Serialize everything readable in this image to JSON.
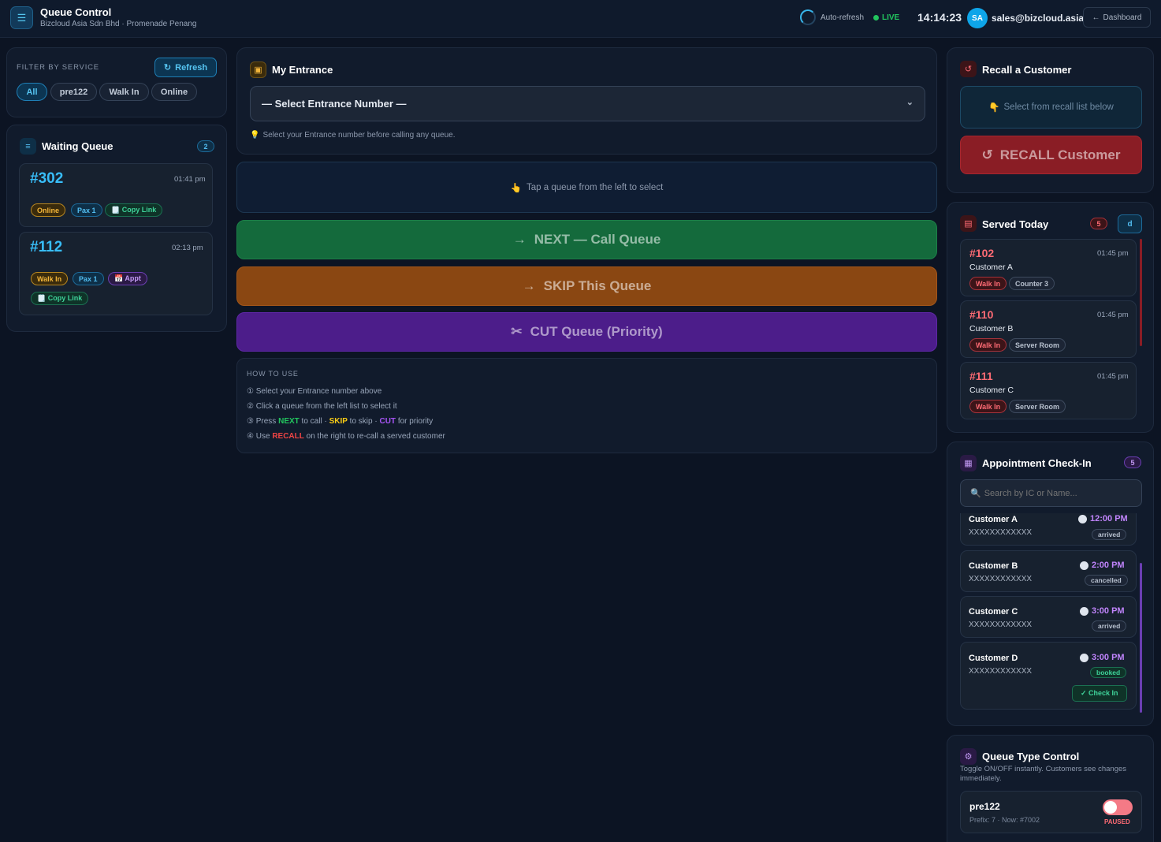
{
  "header": {
    "title": "Queue Control",
    "subtitle": "Bizcloud Asia Sdn Bhd · Promenade Penang",
    "auto_refresh": "Auto-refresh",
    "live": "LIVE",
    "time": "14:14:23",
    "avatar": "SA",
    "email": "sales@bizcloud.asia",
    "dashboard": "Dashboard"
  },
  "filter": {
    "label": "FILTER BY SERVICE",
    "refresh": "Refresh",
    "options": [
      "All",
      "pre122",
      "Walk In",
      "Online"
    ],
    "selected": "All"
  },
  "waiting": {
    "title": "Waiting Queue",
    "count": "2",
    "items": [
      {
        "number": "#302",
        "time": "01:41 pm",
        "type": "Online",
        "pax": "Pax 1",
        "copy": "🗒️ Copy Link"
      },
      {
        "number": "#112",
        "time": "02:13 pm",
        "type": "Walk In",
        "pax": "Pax 1",
        "appt": "📅 Appt",
        "copy": "🗒️ Copy Link"
      }
    ]
  },
  "entrance": {
    "title": "My Entrance",
    "select_placeholder": "— Select Entrance Number —",
    "hint": "Select your Entrance number before calling any queue."
  },
  "selected_queue": {
    "hint": "Tap a queue from the left to select"
  },
  "actions": {
    "next": "NEXT — Call Queue",
    "skip": "SKIP This Queue",
    "cut": "CUT Queue (Priority)"
  },
  "howto": {
    "title": "HOW TO USE",
    "l1": "① Select your Entrance number above",
    "l2": "② Click a queue from the left list to select it",
    "l3_pre": "③ Press ",
    "l3_next": "NEXT",
    "l3_mid1": " to call · ",
    "l3_skip": "SKIP",
    "l3_mid2": " to skip · ",
    "l3_cut": "CUT",
    "l3_post": " for priority",
    "l4_pre": "④ Use ",
    "l4_recall": "RECALL",
    "l4_post": " on the right to re-call a served customer"
  },
  "recall": {
    "title": "Recall a Customer",
    "hint": "Select from recall list below",
    "button": "RECALL Customer"
  },
  "served": {
    "title": "Served Today",
    "count": "5",
    "filter_btn": "d",
    "items": [
      {
        "number": "#102",
        "time": "01:45 pm",
        "name": "Customer A",
        "type": "Walk In",
        "counter": "Counter 3"
      },
      {
        "number": "#110",
        "time": "01:45 pm",
        "name": "Customer B",
        "type": "Walk In",
        "counter": "Server Room"
      },
      {
        "number": "#111",
        "time": "01:45 pm",
        "name": "Customer C",
        "type": "Walk In",
        "counter": "Server Room"
      }
    ]
  },
  "appointments": {
    "title": "Appointment Check-In",
    "count": "5",
    "search_placeholder": "Search by IC or Name...",
    "items": [
      {
        "name": "Customer A",
        "ic": "XXXXXXXXXXXX",
        "time": "12:00 PM",
        "status": "arrived"
      },
      {
        "name": "Customer B",
        "ic": "XXXXXXXXXXXX",
        "time": "2:00 PM",
        "status": "cancelled"
      },
      {
        "name": "Customer C",
        "ic": "XXXXXXXXXXXX",
        "time": "3:00 PM",
        "status": "arrived"
      },
      {
        "name": "Customer D",
        "ic": "XXXXXXXXXXXX",
        "time": "3:00 PM",
        "status": "booked",
        "action": "✓ Check In"
      }
    ]
  },
  "queue_type": {
    "title": "Queue Type Control",
    "desc": "Toggle ON/OFF instantly. Customers see changes immediately.",
    "items": [
      {
        "name": "pre122",
        "meta": "Prefix: 7 · Now: #7002",
        "state": "PAUSED",
        "enabled": false
      }
    ]
  }
}
